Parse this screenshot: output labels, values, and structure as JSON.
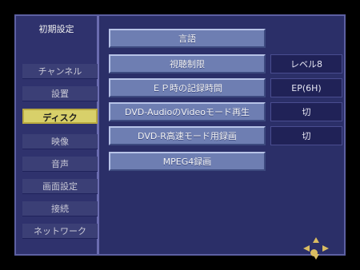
{
  "sidebar": {
    "title": "初期設定",
    "items": [
      {
        "label": "チャンネル"
      },
      {
        "label": "設置"
      },
      {
        "label": "ディスク"
      },
      {
        "label": "映像"
      },
      {
        "label": "音声"
      },
      {
        "label": "画面設定"
      },
      {
        "label": "接続"
      },
      {
        "label": "ネットワーク"
      }
    ],
    "active_label": "ディスク"
  },
  "main": {
    "rows": [
      {
        "label": "言語",
        "value": ""
      },
      {
        "label": "視聴制限",
        "value": "レベル8"
      },
      {
        "label": "ＥＰ時の記録時間",
        "value": "EP(6H)"
      },
      {
        "label": "DVD-AudioのVideoモード再生",
        "value": "切"
      },
      {
        "label": "DVD-R高速モード用録画",
        "value": "切"
      },
      {
        "label": "MPEG4録画",
        "value": ""
      }
    ]
  },
  "icons": {
    "navigation": "direction-pad-icon",
    "select": "select-dot-icon"
  },
  "colors": {
    "background": "#2b2f68",
    "active": "#d8d06a",
    "button": "#6e7eb2"
  }
}
